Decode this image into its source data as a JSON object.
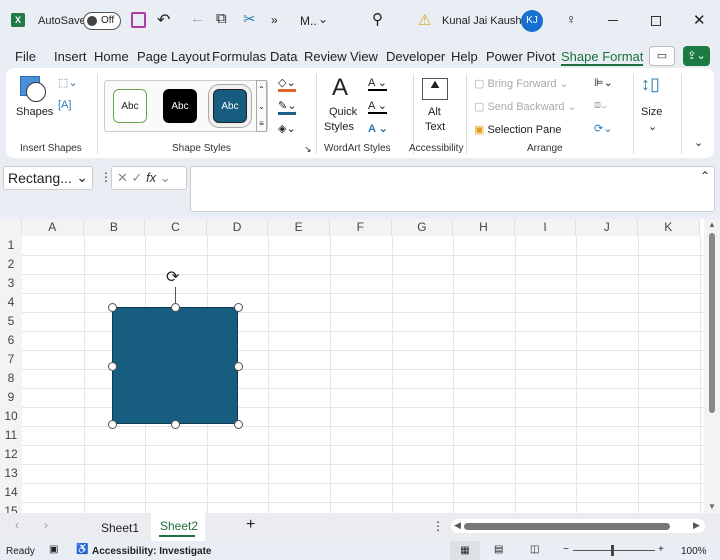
{
  "titlebar": {
    "autosave": "AutoSave",
    "toggle": "Off",
    "filename": "M..",
    "user": "Kunal Jai Kaushik",
    "initials": "KJ"
  },
  "menu": [
    "File",
    "Insert",
    "Home",
    "Page Layout",
    "Formulas",
    "Data",
    "Review",
    "View",
    "Developer",
    "Help",
    "Power Pivot",
    "Shape Format"
  ],
  "ribbon": {
    "shapes": "Shapes",
    "insert_shapes": "Insert Shapes",
    "abc": "Abc",
    "shape_styles": "Shape Styles",
    "quick": "Quick",
    "styles": "Styles",
    "wordart_styles": "WordArt Styles",
    "alt": "Alt",
    "text": "Text",
    "accessibility": "Accessibility",
    "bring_forward": "Bring Forward",
    "send_backward": "Send Backward",
    "selection_pane": "Selection Pane",
    "arrange": "Arrange",
    "size": "Size"
  },
  "formula": {
    "name_box": "Rectang...",
    "fx": "fx",
    "value": ""
  },
  "columns": [
    "A",
    "B",
    "C",
    "D",
    "E",
    "F",
    "G",
    "H",
    "I",
    "J",
    "K"
  ],
  "rows": [
    "1",
    "2",
    "3",
    "4",
    "5",
    "6",
    "7",
    "8",
    "9",
    "10",
    "11",
    "12",
    "13",
    "14",
    "15"
  ],
  "shape": {
    "fill": "#175d80"
  },
  "sheets": [
    "Sheet1",
    "Sheet2"
  ],
  "active_sheet": "Sheet2",
  "status": {
    "ready": "Ready",
    "accessibility": "Accessibility: Investigate",
    "zoom": "100%"
  },
  "colors": {
    "accent": "#1e6e3f",
    "shape": "#175d80"
  }
}
